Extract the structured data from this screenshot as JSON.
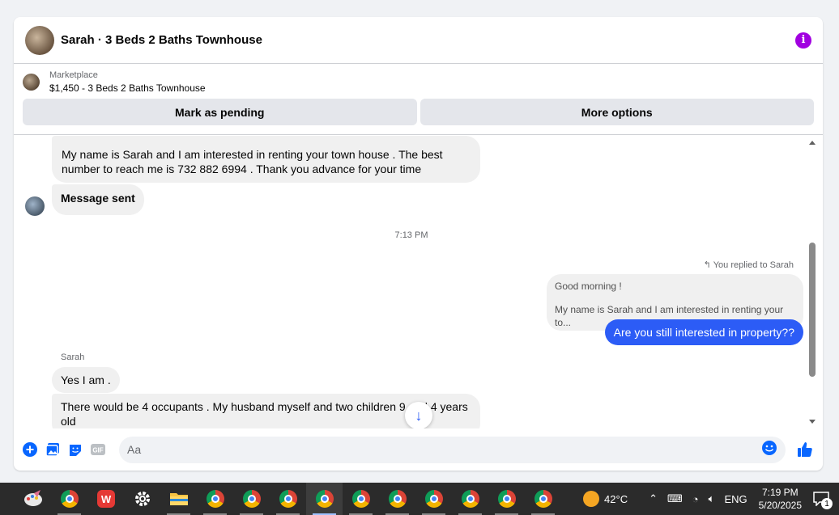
{
  "header": {
    "title": "Sarah · 3 Beds 2 Baths Townhouse"
  },
  "listing": {
    "source": "Marketplace",
    "name": "$1,450 - 3 Beds 2 Baths Townhouse",
    "mark_pending_label": "Mark as pending",
    "more_options_label": "More options"
  },
  "messages": {
    "intro_text": "My name is Sarah and I am interested in renting your town house . The best number to reach me is 732 882 6994 . Thank you advance for your time",
    "message_sent": "Message sent",
    "timestamp": "7:13 PM",
    "replied_label": "You replied to Sarah",
    "quoted_line1": "Good morning !",
    "quoted_line2": "My name is Sarah and I am interested in renting your to...",
    "my_reply": "Are you still interested in property??",
    "sender_name": "Sarah",
    "reply1": "Yes I am .",
    "reply2": "There would be 4 occupants . My husband myself and two children 9 and 4 years old"
  },
  "composer": {
    "placeholder": "Aa"
  },
  "taskbar": {
    "weather": "42°C",
    "language": "ENG",
    "time": "7:19 PM",
    "date": "5/20/2025",
    "notification_count": "1"
  },
  "colors": {
    "accent_blue": "#2c5cf6",
    "info_purple": "#a100e0",
    "messenger_blue": "#0866ff"
  }
}
